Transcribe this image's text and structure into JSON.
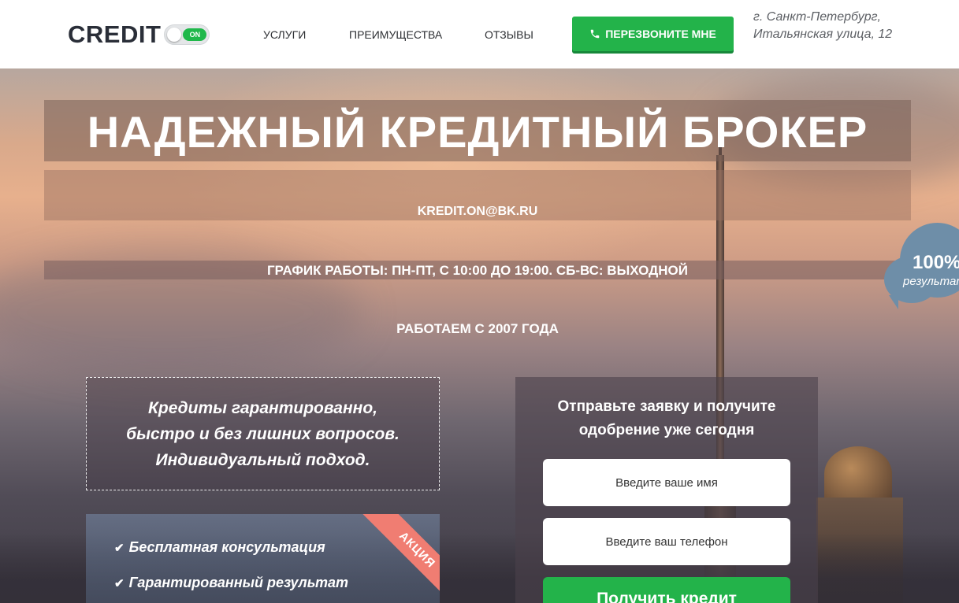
{
  "header": {
    "logo_text": "CREDIT",
    "logo_toggle_label": "ON",
    "nav": [
      {
        "label": "УСЛУГИ"
      },
      {
        "label": "ПРЕИМУЩЕСТВА"
      },
      {
        "label": "ОТЗЫВЫ"
      }
    ],
    "call_button": "ПЕРЕЗВОНИТЕ МНЕ",
    "address_line1": "г. Санкт-Петербург,",
    "address_line2": "Итальянская улица, 12"
  },
  "hero": {
    "title": "НАДЕЖНЫЙ КРЕДИТНЫЙ БРОКЕР",
    "email": "KREDIT.ON@BK.RU",
    "schedule": "ГРАФИК РАБОТЫ: ПН-ПТ, С 10:00 ДО 19:00. СБ-ВС: ВЫХОДНОЙ",
    "since": "РАБОТАЕМ С 2007 ГОДА",
    "badge_value": "100%",
    "badge_label": "результат"
  },
  "promo": {
    "lines": [
      "Кредиты гарантированно,",
      "быстро и без лишних вопросов.",
      "Индивидуальный подход."
    ]
  },
  "features": {
    "items": [
      "Бесплатная консультация",
      "Гарантированный результат"
    ],
    "ribbon": "АКЦИЯ"
  },
  "form": {
    "title_line1": "Отправьте заявку и получите",
    "title_line2": "одобрение уже сегодня",
    "name_placeholder": "Введите ваше имя",
    "phone_placeholder": "Введите ваш телефон",
    "submit": "Получить кредит"
  },
  "colors": {
    "accent_green": "#23b34a",
    "ribbon": "#f07d72",
    "badge": "#6e8ea8"
  }
}
